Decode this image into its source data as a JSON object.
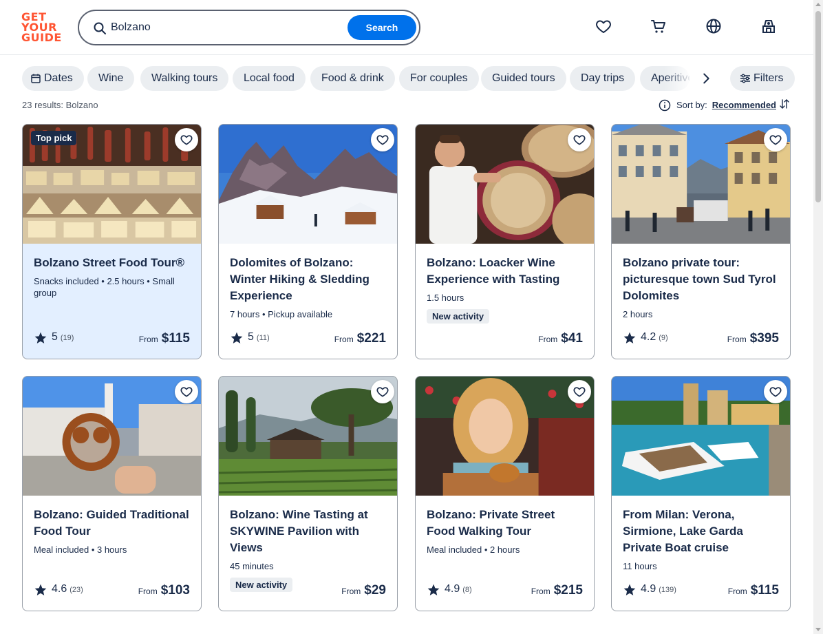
{
  "brand": {
    "logo_lines": [
      "GET",
      "YOUR",
      "GUIDE"
    ],
    "color": "#ff5533"
  },
  "search": {
    "value": "Bolzano",
    "placeholder": "Search",
    "button_label": "Search",
    "button_color": "#0071eb"
  },
  "header_icons": [
    "heart-icon",
    "cart-icon",
    "globe-icon",
    "account-icon"
  ],
  "filters": {
    "chips": [
      "Dates",
      "Wine",
      "Walking tours",
      "Local food",
      "Food & drink",
      "For couples",
      "Guided tours",
      "Day trips",
      "Aperitivo"
    ],
    "filters_label": "Filters"
  },
  "results": {
    "count_text": "23 results: Bolzano"
  },
  "sort": {
    "label": "Sort by:",
    "value": "Recommended"
  },
  "cards": [
    {
      "badge": "Top pick",
      "title": "Bolzano Street Food Tour®",
      "meta": "Snacks included • 2.5 hours • Small group",
      "tag": "",
      "rating": "5",
      "reviews": "(19)",
      "from": "From",
      "price": "$115",
      "image": "cheese-market"
    },
    {
      "badge": "",
      "title": "Dolomites of Bolzano: Winter Hiking & Sledding Experience",
      "meta": "7 hours • Pickup available",
      "tag": "",
      "rating": "5",
      "reviews": "(11)",
      "from": "From",
      "price": "$221",
      "image": "snowy-mountains"
    },
    {
      "badge": "",
      "title": "Bolzano: Loacker Wine Experience with Tasting",
      "meta": "1.5 hours",
      "tag": "New activity",
      "rating": "",
      "reviews": "",
      "from": "From",
      "price": "$41",
      "image": "wine-barrels"
    },
    {
      "badge": "",
      "title": "Bolzano private tour: picturesque town Sud Tyrol Dolomites",
      "meta": "2 hours",
      "tag": "",
      "rating": "4.2",
      "reviews": "(9)",
      "from": "From",
      "price": "$395",
      "image": "town-square"
    },
    {
      "badge": "",
      "title": "Bolzano: Guided Traditional Food Tour",
      "meta": "Meal included • 3 hours",
      "tag": "",
      "rating": "4.6",
      "reviews": "(23)",
      "from": "From",
      "price": "$103",
      "image": "pretzel-square"
    },
    {
      "badge": "",
      "title": "Bolzano: Wine Tasting at SKYWINE Pavilion with Views",
      "meta": "45 minutes",
      "tag": "New activity",
      "rating": "",
      "reviews": "",
      "from": "From",
      "price": "$29",
      "image": "vineyard-pavilion"
    },
    {
      "badge": "",
      "title": "Bolzano: Private Street Food Walking Tour",
      "meta": "Meal included • 2 hours",
      "tag": "",
      "rating": "4.9",
      "reviews": "(8)",
      "from": "From",
      "price": "$215",
      "image": "woman-pretzel"
    },
    {
      "badge": "",
      "title": "From Milan: Verona, Sirmione, Lake Garda Private Boat cruise",
      "meta": "11 hours",
      "tag": "",
      "rating": "4.9",
      "reviews": "(139)",
      "from": "From",
      "price": "$115",
      "image": "lake-boats"
    }
  ]
}
